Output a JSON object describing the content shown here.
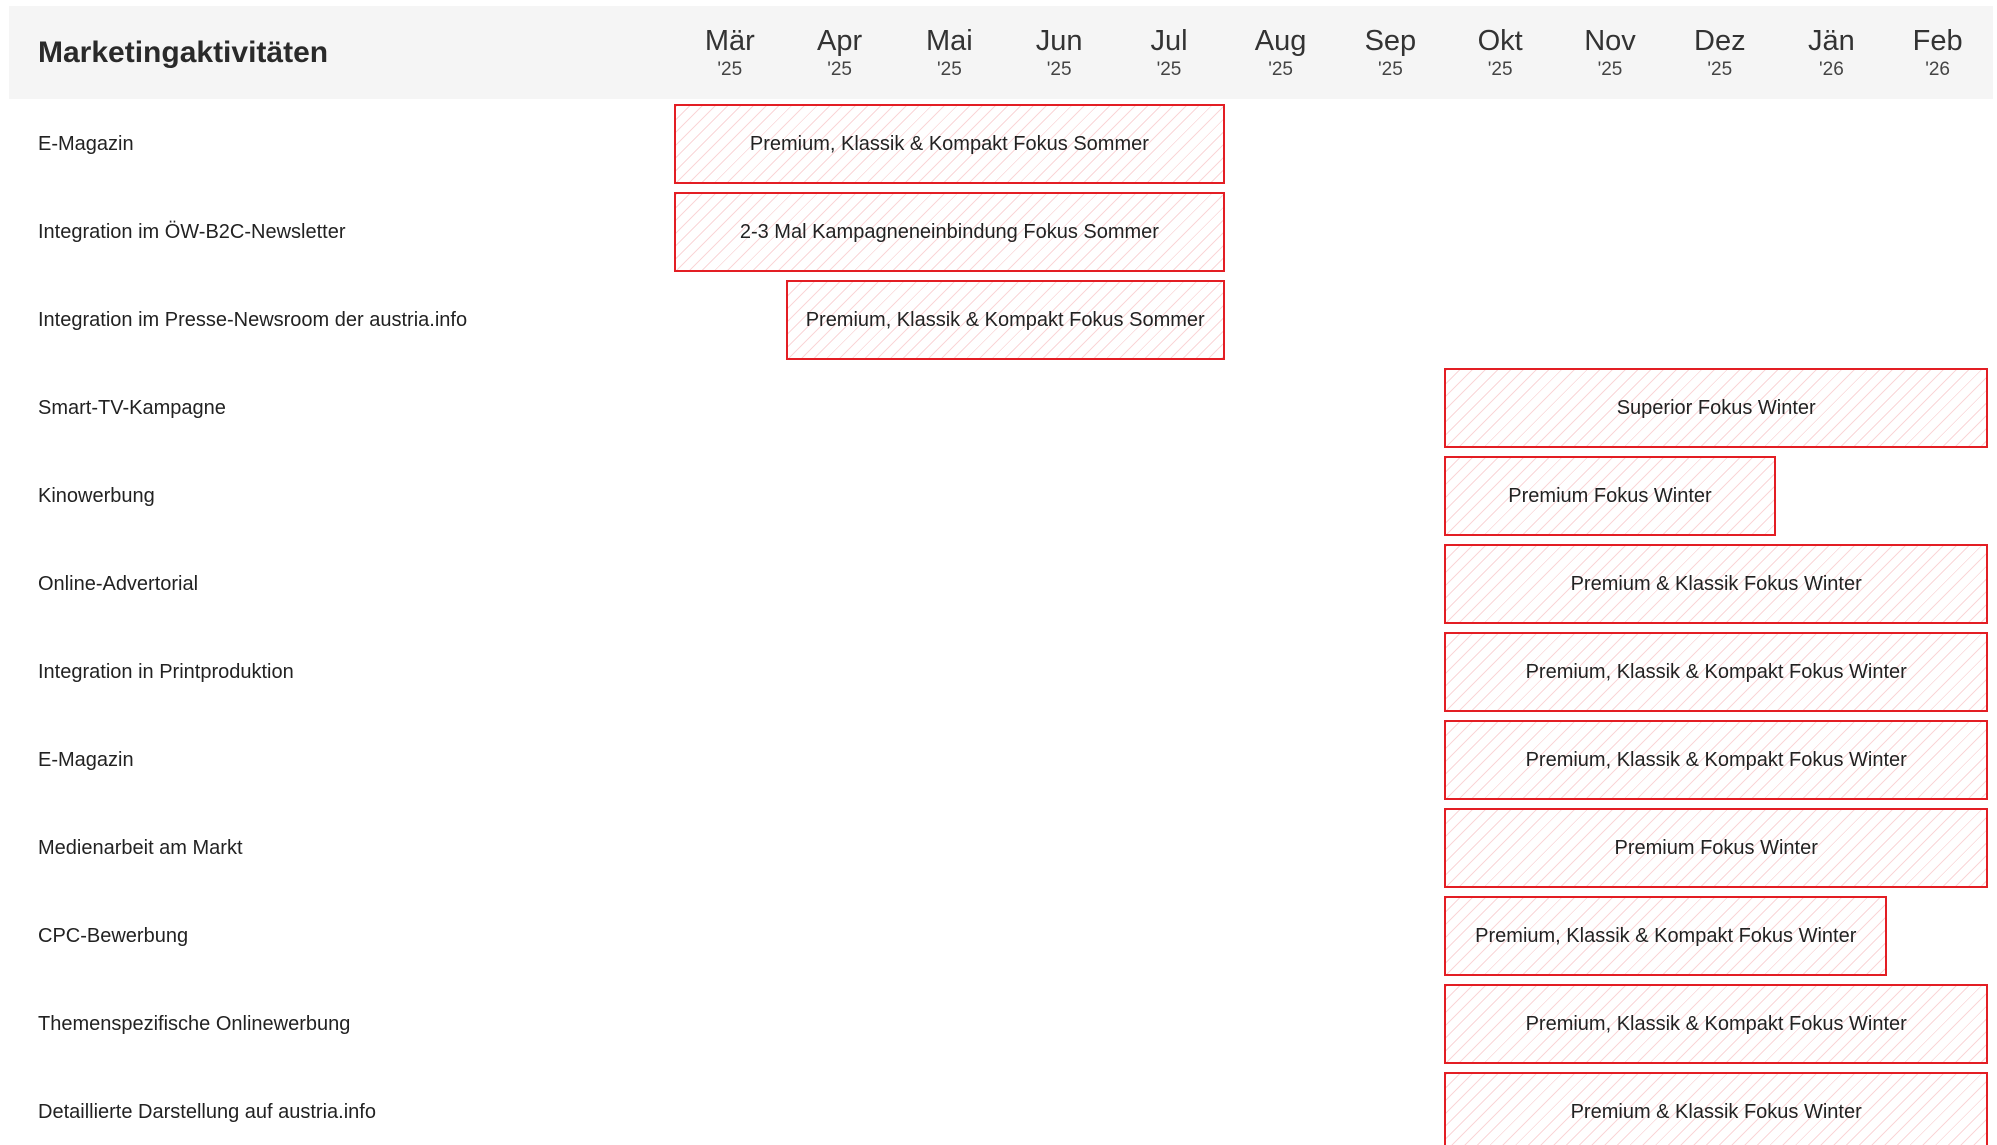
{
  "chart_data": {
    "type": "gantt",
    "title": "Marketingaktivitäten",
    "months": [
      {
        "name": "Mär",
        "year": "'25"
      },
      {
        "name": "Apr",
        "year": "'25"
      },
      {
        "name": "Mai",
        "year": "'25"
      },
      {
        "name": "Jun",
        "year": "'25"
      },
      {
        "name": "Jul",
        "year": "'25"
      },
      {
        "name": "Aug",
        "year": "'25"
      },
      {
        "name": "Sep",
        "year": "'25"
      },
      {
        "name": "Okt",
        "year": "'25"
      },
      {
        "name": "Nov",
        "year": "'25"
      },
      {
        "name": "Dez",
        "year": "'25"
      },
      {
        "name": "Jän",
        "year": "'26"
      },
      {
        "name": "Feb",
        "year": "'26"
      }
    ],
    "rows": [
      {
        "label": "E-Magazin",
        "bar": "Premium, Klassik & Kompakt Fokus Sommer",
        "start": "2025-03-01",
        "end": "2025-07-31"
      },
      {
        "label": "Integration im ÖW-B2C-Newsletter",
        "bar": "2-3 Mal Kampagneneinbindung Fokus Sommer",
        "start": "2025-03-01",
        "end": "2025-07-31"
      },
      {
        "label": "Integration im Presse-Newsroom der austria.info",
        "bar": "Premium, Klassik & Kompakt Fokus Sommer",
        "start": "2025-04-01",
        "end": "2025-07-31"
      },
      {
        "label": "Smart-TV-Kampagne",
        "bar": "Superior Fokus Winter",
        "start": "2025-10-01",
        "end": "2026-02-28"
      },
      {
        "label": "Kinowerbung",
        "bar": "Premium Fokus Winter",
        "start": "2025-10-01",
        "end": "2025-12-31"
      },
      {
        "label": "Online-Advertorial",
        "bar": "Premium & Klassik Fokus Winter",
        "start": "2025-10-01",
        "end": "2026-02-28"
      },
      {
        "label": "Integration in Printproduktion",
        "bar": "Premium, Klassik & Kompakt Fokus Winter",
        "start": "2025-10-01",
        "end": "2026-02-28"
      },
      {
        "label": "E-Magazin",
        "bar": "Premium, Klassik & Kompakt Fokus Winter",
        "start": "2025-10-01",
        "end": "2026-02-28"
      },
      {
        "label": "Medienarbeit am Markt",
        "bar": "Premium Fokus Winter",
        "start": "2025-10-01",
        "end": "2026-02-28"
      },
      {
        "label": "CPC-Bewerbung",
        "bar": "Premium, Klassik & Kompakt Fokus Winter",
        "start": "2025-10-01",
        "end": "2026-01-31"
      },
      {
        "label": "Themenspezifische Onlinewerbung",
        "bar": "Premium, Klassik & Kompakt Fokus Winter",
        "start": "2025-10-01",
        "end": "2026-02-28"
      },
      {
        "label": "Detaillierte Darstellung auf austria.info",
        "bar": "Premium & Klassik Fokus Winter",
        "start": "2025-10-01",
        "end": "2026-02-28"
      }
    ],
    "colors": {
      "bar_border": "#e31e24",
      "bar_hatch": "#f5b5b7",
      "header_background": "#f5f5f5",
      "text": "#222222"
    }
  }
}
